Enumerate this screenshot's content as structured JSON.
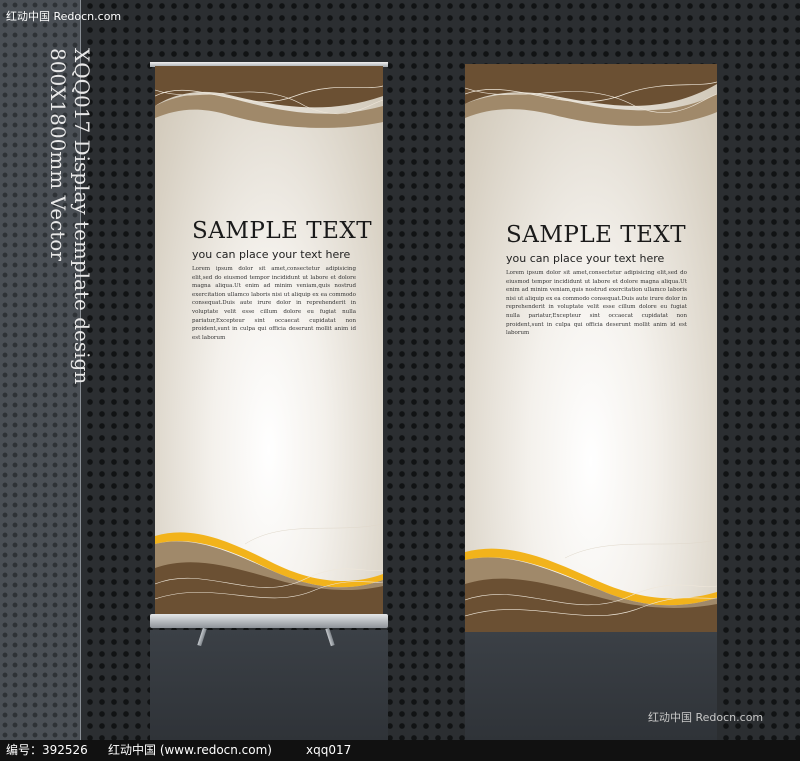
{
  "watermark": {
    "top_left": "红动中国 Redocn.com",
    "bottom_right": "红动中国 Redocn.com"
  },
  "side_title": {
    "line1": "XQQ017 Display template design",
    "line2": "800X1800mm Vector"
  },
  "banners": [
    {
      "heading": "SAMPLE TEXT",
      "subheading": "you can place your text here",
      "body": "Lorem ipsum dolor sit amet,consectetur adipisicing elit,sed do eiusmod tempor incididunt ut labore et dolore magna aliqua.Ut enim ad minim veniam,quis nostrud exercitation ullamco laboris nisi ut aliquip ex ea commodo consequat.Duis aute irure dolor in reprehenderit in voluptate velit esse cillum dolore eu fugiat nulla pariatur,Excepteur sint occaecat cupidatat non proident,sunt in culpa qui officia deserunt mollit anim id est laborum"
    },
    {
      "heading": "SAMPLE TEXT",
      "subheading": "you can place your text here",
      "body": "Lorem ipsum dolor sit amet,consectetur adipisicing elit,sed do eiusmod tempor incididunt ut labore et dolore magna aliqua.Ut enim ad minim veniam,quis nostrud exercitation ullamco laboris nisi ut aliquip ex ea commodo consequat.Duis aute irure dolor in reprehenderit in voluptate velit esse cillum dolore eu fugiat nulla pariatur,Excepteur sint occaecat cupidatat non proident,sunt in culpa qui officia deserunt mollit anim id est laborum"
    }
  ],
  "footer": {
    "id_label": "编号：392526",
    "site": "红动中国 (www.redocn.com)",
    "code": "xqq017"
  },
  "colors": {
    "wave_brown": "#6b5033",
    "wave_tan": "#a0896a",
    "wave_gold": "#f2b31b"
  }
}
